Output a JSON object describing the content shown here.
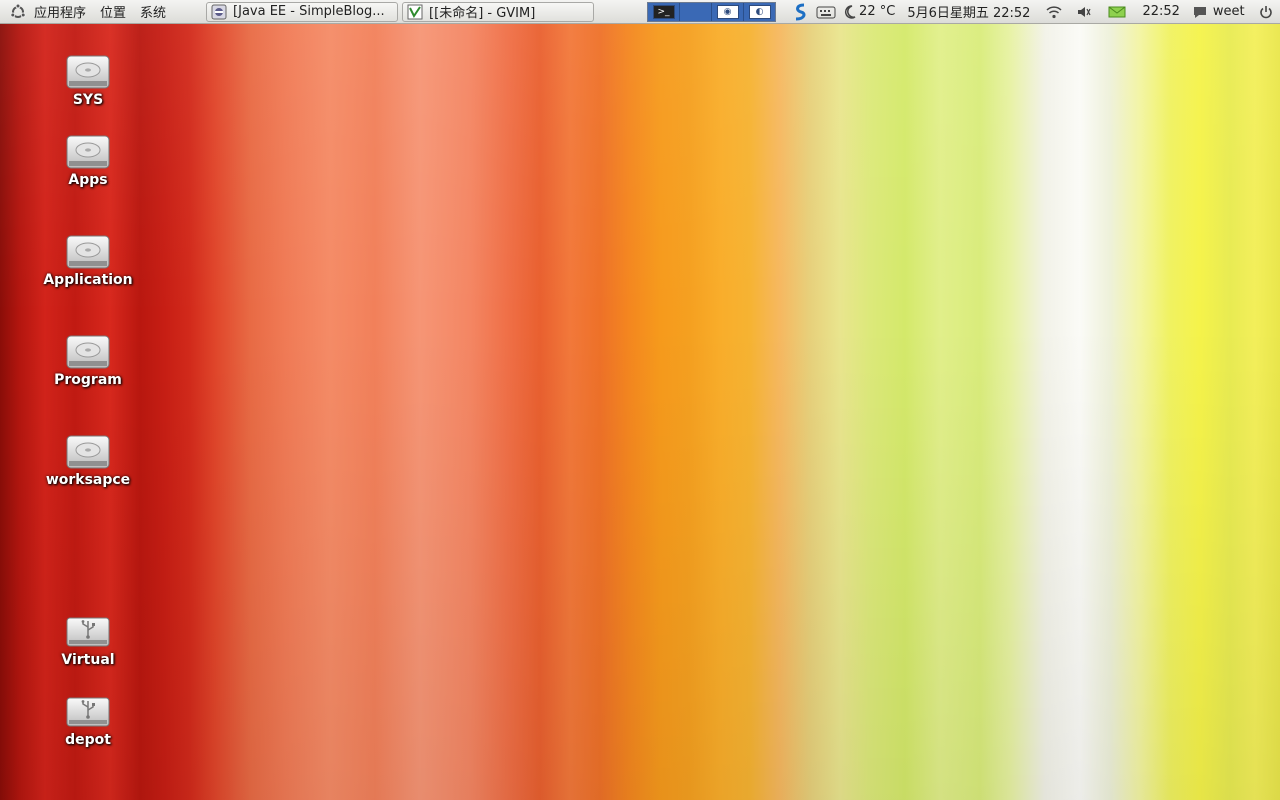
{
  "panel": {
    "menus": [
      "应用程序",
      "位置",
      "系统"
    ],
    "tasks": [
      {
        "label": "[Java EE - SimpleBlog...",
        "icon": "eclipse-icon"
      },
      {
        "label": "[[未命名] - GVIM]",
        "icon": "gvim-icon"
      }
    ],
    "weather": "22 °C",
    "date": "5月6日星期五 22:52",
    "time": "22:52",
    "user": "weet"
  },
  "desktop": {
    "icons": [
      {
        "label": "SYS",
        "type": "drive-icon"
      },
      {
        "label": "Apps",
        "type": "drive-icon"
      },
      {
        "label": "Application",
        "type": "drive-icon"
      },
      {
        "label": "Program",
        "type": "drive-icon"
      },
      {
        "label": "worksapce",
        "type": "drive-icon"
      },
      {
        "label": "Virtual",
        "type": "usb-drive-icon"
      },
      {
        "label": "depot",
        "type": "usb-drive-icon"
      }
    ]
  },
  "colors": {
    "panel_bg": "#e6e6e3",
    "workspace_active": "#3a69b5"
  }
}
